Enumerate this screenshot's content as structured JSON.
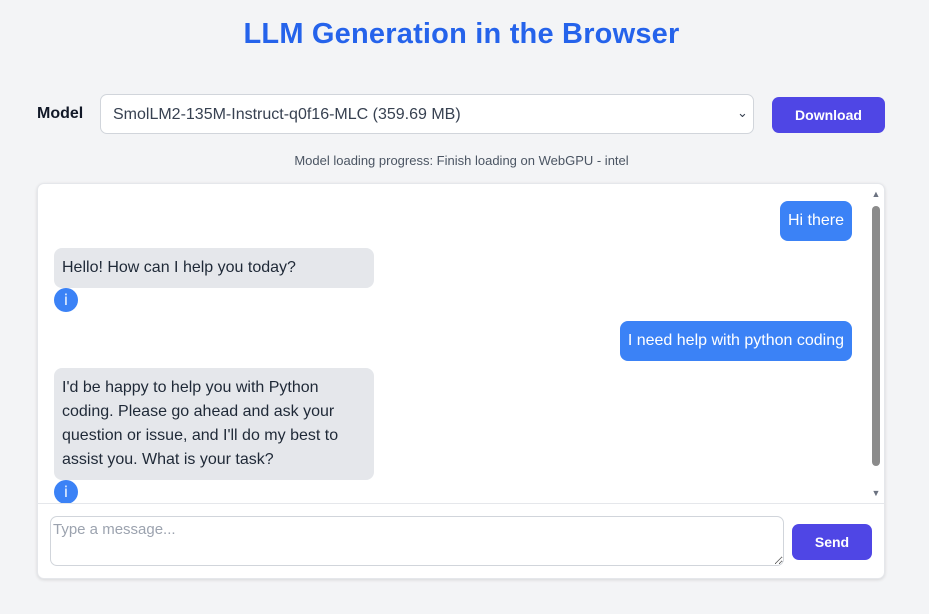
{
  "header": {
    "title": "LLM Generation in the Browser"
  },
  "model": {
    "label": "Model",
    "selected": "SmolLM2-135M-Instruct-q0f16-MLC (359.69 MB)",
    "download_label": "Download"
  },
  "progress": {
    "text": "Model loading progress: Finish loading on WebGPU - intel"
  },
  "chat": {
    "messages": [
      {
        "role": "user",
        "text": "Hi there"
      },
      {
        "role": "assistant",
        "text": "Hello! How can I help you today?",
        "info_icon": "i"
      },
      {
        "role": "user",
        "text": "I need help with python coding"
      },
      {
        "role": "assistant",
        "text": "I'd be happy to help you with Python coding. Please go ahead and ask your question or issue, and I'll do my best to assist you. What is your task?",
        "info_icon": "i"
      }
    ]
  },
  "composer": {
    "placeholder": "Type a message...",
    "send_label": "Send"
  },
  "colors": {
    "title": "#2563eb",
    "button": "#4f46e5",
    "user_bubble": "#3b82f6",
    "assistant_bubble": "#e5e7eb"
  }
}
